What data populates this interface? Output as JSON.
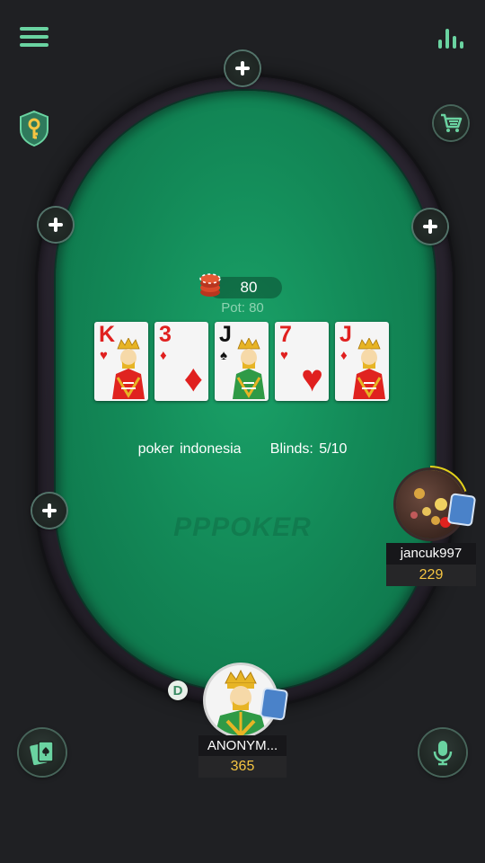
{
  "header": {
    "menu_icon": "hamburger-menu-icon",
    "stats_icon": "bar-chart-icon",
    "key_icon": "shield-key-icon",
    "shop_icon": "shopping-cart-icon"
  },
  "table": {
    "watermark": "PPPOKER",
    "name": "poker indonesia",
    "blinds_label": "Blinds: 5/10",
    "pot_amount": "80",
    "pot_label": "Pot: 80",
    "empty_seats": 4
  },
  "board": [
    {
      "rank": "K",
      "suit": "♥",
      "color": "red",
      "face": true
    },
    {
      "rank": "3",
      "suit": "♦",
      "color": "red",
      "face": false
    },
    {
      "rank": "J",
      "suit": "♠",
      "color": "blk",
      "face": true
    },
    {
      "rank": "7",
      "suit": "♥",
      "color": "red",
      "face": false
    },
    {
      "rank": "J",
      "suit": "♦",
      "color": "red",
      "face": true
    }
  ],
  "players": {
    "opponent": {
      "name": "jancuk997",
      "stack": "229"
    },
    "hero": {
      "name": "ANONYM...",
      "stack": "365"
    }
  },
  "dealer_button": "D",
  "bottom": {
    "cards_icon": "cards-icon",
    "mic_icon": "microphone-icon"
  },
  "colors": {
    "felt": "#138a58",
    "accent": "#6ad3a1",
    "stack": "#f5c542"
  }
}
